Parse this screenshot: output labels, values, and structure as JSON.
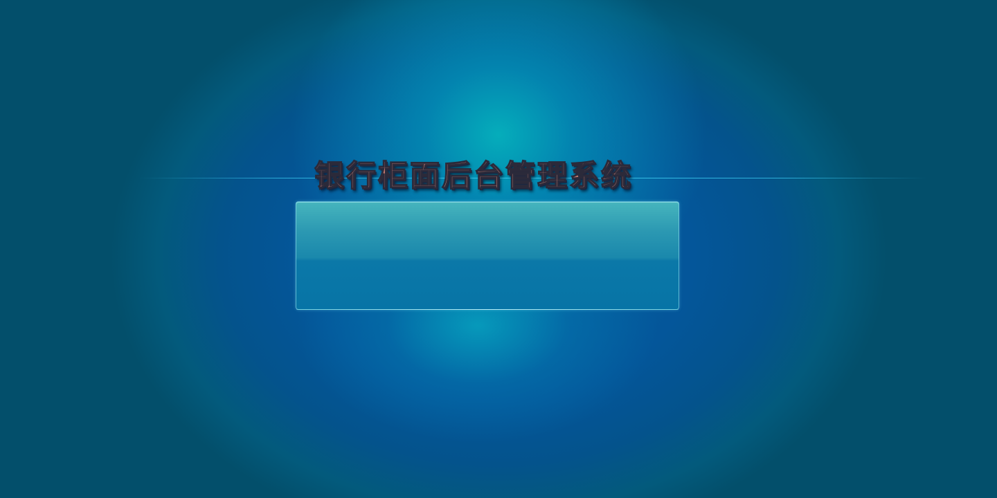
{
  "app": {
    "title": "银行柜面后台管理系统"
  },
  "theme": {
    "background_center": "#05adbb",
    "background_mid": "#04569a",
    "background_edge": "#034f6b",
    "title_fill": "#c47b70",
    "title_outline": "#2b2a3a",
    "panel_top": "#46b5bd",
    "panel_bottom": "#0774a6",
    "accent_line": "#3cc8eb"
  },
  "login_panel": {
    "content": ""
  }
}
